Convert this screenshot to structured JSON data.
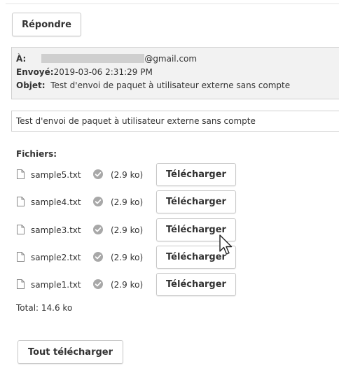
{
  "toolbar": {
    "reply_label": "Répondre"
  },
  "header": {
    "to_label": "À:",
    "to_domain": "@gmail.com",
    "sent_label": "Envoyé:",
    "sent_value": "2019-03-06 2:31:29 PM",
    "subject_label": "Objet:",
    "subject_value": "Test d'envoi de paquet à utilisateur externe sans compte"
  },
  "message": {
    "body": "Test d'envoi de paquet à utilisateur externe sans compte"
  },
  "files": {
    "title": "Fichiers:",
    "download_label": "Télécharger",
    "items": [
      {
        "name": "sample5.txt",
        "size": "(2.9 ko)"
      },
      {
        "name": "sample4.txt",
        "size": "(2.9 ko)"
      },
      {
        "name": "sample3.txt",
        "size": "(2.9 ko)"
      },
      {
        "name": "sample2.txt",
        "size": "(2.9 ko)"
      },
      {
        "name": "sample1.txt",
        "size": "(2.9 ko)"
      }
    ],
    "total": "Total: 14.6 ko",
    "download_all_label": "Tout télécharger"
  },
  "colors": {
    "header_bg": "#f2f2f2",
    "border": "#d0d0d0",
    "check_icon": "#a8a8a8"
  }
}
